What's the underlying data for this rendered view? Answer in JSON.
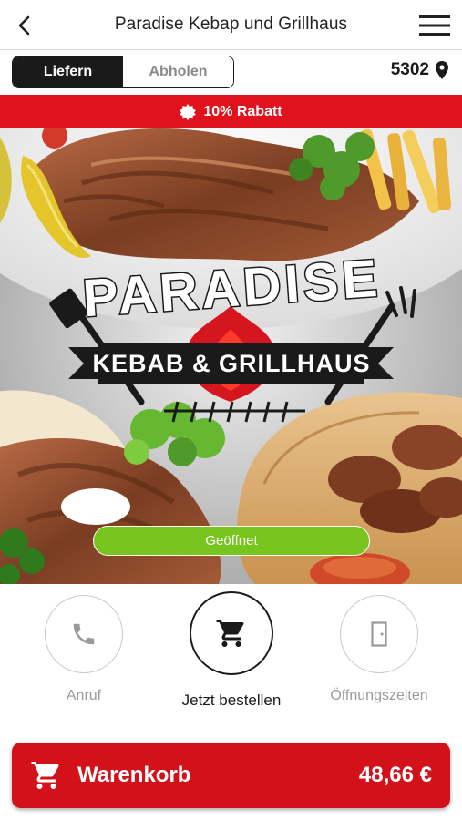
{
  "header": {
    "title": "Paradise Kebap und Grillhaus"
  },
  "mode": {
    "options": [
      "Liefern",
      "Abholen"
    ],
    "selected": "Liefern",
    "postal_code": "5302"
  },
  "discount": {
    "label": "10% Rabatt"
  },
  "hero": {
    "logo_line1": "PARADISE",
    "logo_line2": "KEBAB & GRILLHAUS",
    "status": "Geöffnet",
    "status_color": "#78c51f"
  },
  "actions": {
    "call": "Anruf",
    "order": "Jetzt bestellen",
    "hours": "Öffnungszeiten"
  },
  "cart": {
    "label": "Warenkorb",
    "total": "48,66 €"
  },
  "colors": {
    "brand_red": "#e2121c",
    "cart_red": "#d3111b",
    "dark": "#1a1a1a"
  }
}
